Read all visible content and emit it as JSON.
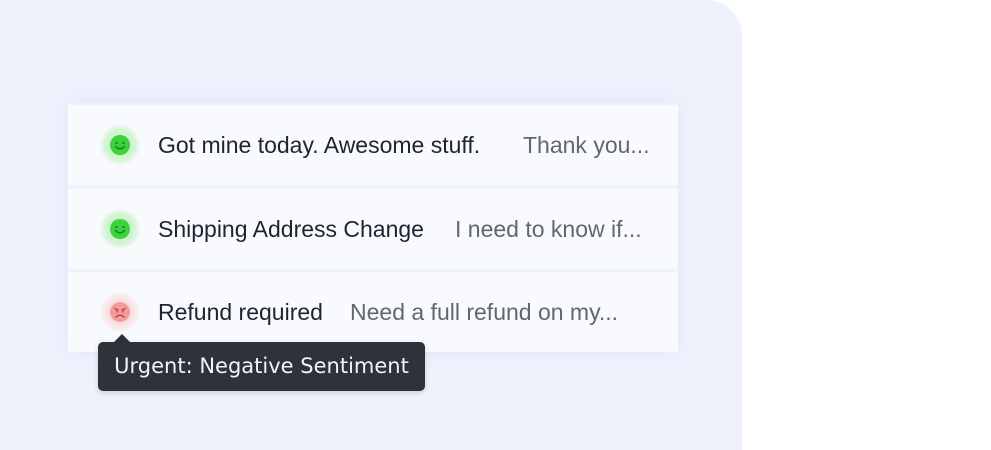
{
  "colors": {
    "panel_background": "#eef2fd",
    "row_background": "#f9fafe",
    "positive": "#39d13a",
    "negative": "#f08080",
    "tooltip_background": "#2e323b"
  },
  "messages": [
    {
      "sentiment": "positive",
      "icon": "smiley-face-icon",
      "subject": "Got mine today. Awesome stuff.",
      "preview": "Thank you..."
    },
    {
      "sentiment": "positive",
      "icon": "smiley-face-icon",
      "subject": "Shipping Address Change",
      "preview": "I need to know if..."
    },
    {
      "sentiment": "negative",
      "icon": "angry-face-icon",
      "subject": "Refund required",
      "preview": "Need a full refund on my..."
    }
  ],
  "tooltip": {
    "text": "Urgent: Negative Sentiment"
  }
}
